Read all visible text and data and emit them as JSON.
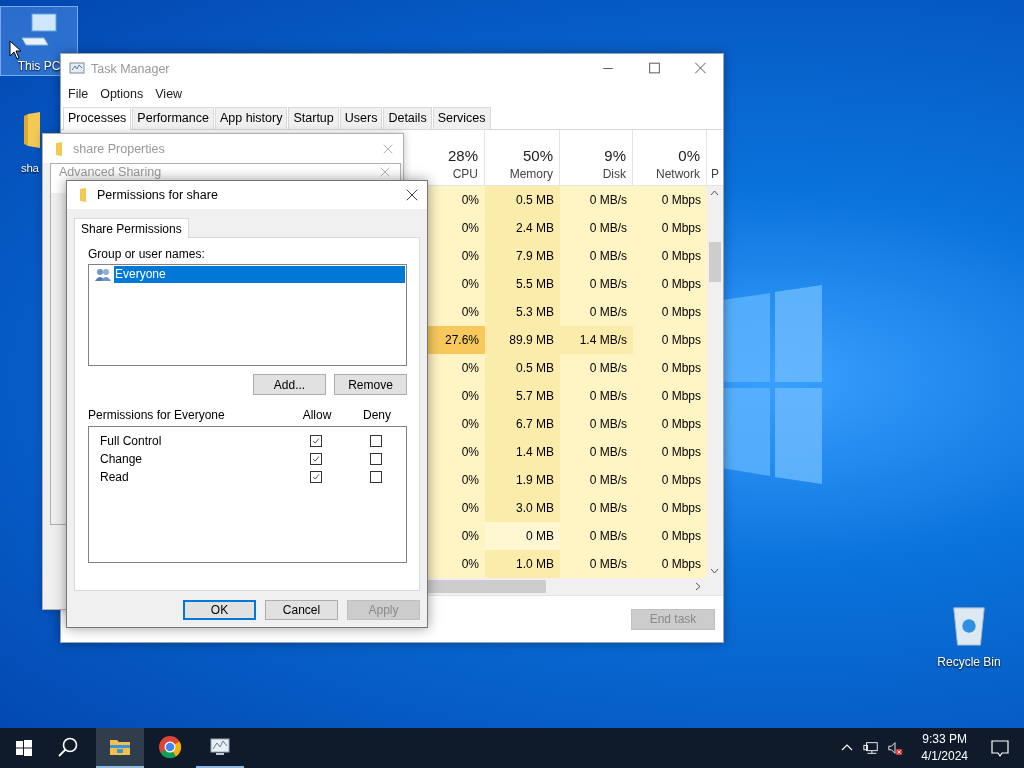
{
  "desktop_icons": [
    {
      "kind": "computer",
      "label": "This PC",
      "selected": true
    },
    {
      "kind": "folder",
      "label": "sha",
      "selected": false
    },
    {
      "kind": "recycle",
      "label": "Recycle Bin",
      "selected": false
    }
  ],
  "task_manager": {
    "title": "Task Manager",
    "menu": [
      "File",
      "Options",
      "View"
    ],
    "tabs": [
      {
        "label": "Processes",
        "selected": true
      },
      {
        "label": "Performance",
        "selected": false
      },
      {
        "label": "App history",
        "selected": false
      },
      {
        "label": "Startup",
        "selected": false
      },
      {
        "label": "Users",
        "selected": false
      },
      {
        "label": "Details",
        "selected": false
      },
      {
        "label": "Services",
        "selected": false
      }
    ],
    "columns": [
      {
        "percent": "28%",
        "label": "CPU"
      },
      {
        "percent": "50%",
        "label": "Memory"
      },
      {
        "percent": "9%",
        "label": "Disk"
      },
      {
        "percent": "0%",
        "label": "Network"
      },
      {
        "label": "P"
      }
    ],
    "rows": [
      [
        {
          "text": "0%"
        },
        {
          "text": "0.5 MB"
        },
        {
          "text": "0 MB/s"
        },
        {
          "text": "0 Mbps"
        }
      ],
      [
        {
          "text": "0%"
        },
        {
          "text": "2.4 MB"
        },
        {
          "text": "0 MB/s"
        },
        {
          "text": "0 Mbps"
        }
      ],
      [
        {
          "text": "0%"
        },
        {
          "text": "7.9 MB"
        },
        {
          "text": "0 MB/s"
        },
        {
          "text": "0 Mbps"
        }
      ],
      [
        {
          "text": "0%"
        },
        {
          "text": "5.5 MB"
        },
        {
          "text": "0 MB/s"
        },
        {
          "text": "0 Mbps"
        }
      ],
      [
        {
          "text": "0%"
        },
        {
          "text": "5.3 MB"
        },
        {
          "text": "0 MB/s"
        },
        {
          "text": "0 Mbps"
        }
      ],
      [
        {
          "text": "27.6%",
          "color": "#f7c95c"
        },
        {
          "text": "89.9 MB"
        },
        {
          "text": "1.4 MB/s",
          "color": "#fcecac"
        },
        {
          "text": "0 Mbps"
        }
      ],
      [
        {
          "text": "0%"
        },
        {
          "text": "0.5 MB"
        },
        {
          "text": "0 MB/s"
        },
        {
          "text": "0 Mbps"
        }
      ],
      [
        {
          "text": "0%"
        },
        {
          "text": "5.7 MB"
        },
        {
          "text": "0 MB/s"
        },
        {
          "text": "0 Mbps"
        }
      ],
      [
        {
          "text": "0%"
        },
        {
          "text": "6.7 MB"
        },
        {
          "text": "0 MB/s"
        },
        {
          "text": "0 Mbps"
        }
      ],
      [
        {
          "text": "0%"
        },
        {
          "text": "1.4 MB"
        },
        {
          "text": "0 MB/s"
        },
        {
          "text": "0 Mbps"
        }
      ],
      [
        {
          "text": "0%"
        },
        {
          "text": "1.9 MB"
        },
        {
          "text": "0 MB/s"
        },
        {
          "text": "0 Mbps"
        }
      ],
      [
        {
          "text": "0%"
        },
        {
          "text": "3.0 MB"
        },
        {
          "text": "0 MB/s"
        },
        {
          "text": "0 Mbps"
        }
      ],
      [
        {
          "text": "0%"
        },
        {
          "text": "0 MB",
          "color": "#fff6d2"
        },
        {
          "text": "0 MB/s"
        },
        {
          "text": "0 Mbps"
        }
      ],
      [
        {
          "text": "0%"
        },
        {
          "text": "1.0 MB"
        },
        {
          "text": "0 MB/s"
        },
        {
          "text": "0 Mbps"
        }
      ]
    ],
    "end_task": {
      "label": "End task",
      "disabled": true
    }
  },
  "properties_window": {
    "title": "share Properties"
  },
  "advanced_sharing": {
    "title": "Advanced Sharing"
  },
  "permissions_dialog": {
    "title": "Permissions for share",
    "tab": "Share Permissions",
    "group_label": "Group or user names:",
    "users": [
      {
        "name": "Everyone",
        "selected": true
      }
    ],
    "list_buttons": [
      "Add...",
      "Remove"
    ],
    "permissions_label": "Permissions for Everyone",
    "allow_label": "Allow",
    "deny_label": "Deny",
    "permissions": [
      {
        "name": "Full Control",
        "allow": true,
        "deny": false
      },
      {
        "name": "Change",
        "allow": true,
        "deny": false
      },
      {
        "name": "Read",
        "allow": true,
        "deny": false
      }
    ],
    "footer_buttons": [
      {
        "label": "OK",
        "default": true,
        "disabled": false
      },
      {
        "label": "Cancel",
        "default": false,
        "disabled": false
      },
      {
        "label": "Apply",
        "default": false,
        "disabled": true
      }
    ]
  },
  "taskbar": {
    "apps": [
      {
        "kind": "explorer",
        "active": true,
        "running": true
      },
      {
        "kind": "chrome",
        "active": false,
        "running": false
      },
      {
        "kind": "taskmgr",
        "active": false,
        "running": true
      }
    ],
    "time": "9:33 PM",
    "date": "4/1/2024"
  }
}
